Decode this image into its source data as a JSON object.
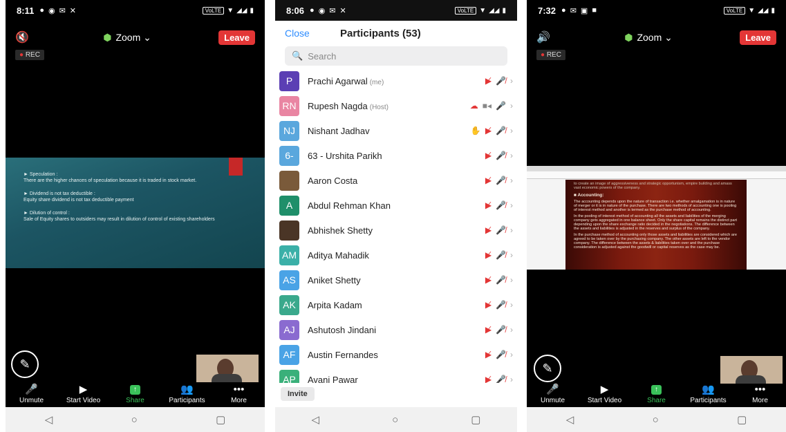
{
  "left": {
    "time": "8:11",
    "network_badge": "VoLTE",
    "meeting_name": "Zoom",
    "leave_label": "Leave",
    "rec_label": "REC",
    "slide": {
      "b1_head": "Speculation :",
      "b1_text": "There are the higher chances of speculation because it is traded in stock market.",
      "b2_head": "Dividend is not tax deductible :",
      "b2_text": "Equity share dividend is not tax deductible payment",
      "b3_head": "Dilution of control :",
      "b3_text": "Sale of Equity shares to outsiders may result in dilution of control of existing shareholders"
    },
    "toolbar": [
      "Unmute",
      "Start Video",
      "Share",
      "Participants",
      "More"
    ]
  },
  "middle": {
    "time": "8:06",
    "network_badge": "VoLTE",
    "close_label": "Close",
    "title": "Participants (53)",
    "search_placeholder": "Search",
    "participants": [
      {
        "initials": "P",
        "name": "Prachi Agarwal",
        "tag": "(me)",
        "color": "#5b3fb4"
      },
      {
        "initials": "RN",
        "name": "Rupesh Nagda",
        "tag": "(Host)",
        "color": "#e985a2"
      },
      {
        "initials": "NJ",
        "name": "Nishant Jadhav",
        "tag": "",
        "color": "#5aa7dd"
      },
      {
        "initials": "6-",
        "name": "63 - Urshita Parikh",
        "tag": "",
        "color": "#5aa7dd"
      },
      {
        "initials": "",
        "name": "Aaron Costa",
        "tag": "",
        "color": "#7a5a3a"
      },
      {
        "initials": "A",
        "name": "Abdul Rehman Khan",
        "tag": "",
        "color": "#1f8f6a"
      },
      {
        "initials": "",
        "name": "Abhishek Shetty",
        "tag": "",
        "color": "#4a3526"
      },
      {
        "initials": "AM",
        "name": "Aditya Mahadik",
        "tag": "",
        "color": "#3bb0a8"
      },
      {
        "initials": "AS",
        "name": "Aniket Shetty",
        "tag": "",
        "color": "#4aa3e6"
      },
      {
        "initials": "AK",
        "name": "Arpita Kadam",
        "tag": "",
        "color": "#3aa98c"
      },
      {
        "initials": "AJ",
        "name": "Ashutosh Jindani",
        "tag": "",
        "color": "#8a6bd0"
      },
      {
        "initials": "AF",
        "name": "Austin Fernandes",
        "tag": "",
        "color": "#4aa3e6"
      },
      {
        "initials": "AP",
        "name": "Avani Pawar",
        "tag": "",
        "color": "#3ab07a"
      }
    ],
    "invite_label": "Invite"
  },
  "right": {
    "time": "7:32",
    "network_badge": "VoLTE",
    "meeting_name": "Zoom",
    "leave_label": "Leave",
    "rec_label": "REC",
    "doc_heading": "Accounting:",
    "doc_p1": "The accounting depends upon the nature of transaction i.e. whether amalgamation is in nature of merger or it is in nature of the purchase. There are two methods of accounting one is pooling of interest method and another is termed as the purchase method of accounting.",
    "doc_p2": "In the pooling of interest method of accounting all the assets and liabilities of the merging company gets aggregated in one balance sheet. Only the share capital remains the distinct part depending upon the share exchange ratio decided in the negotiations. The difference between the assets and liabilities is adjusted in the reserves and surplus of the company.",
    "doc_p3": "In the purchase method of accounting only those assets and liabilities are considered which are agreed to be taken over by the purchasing company. The other assets are left to the vendor company. The difference between the assets & liabilities taken over and the purchase consideration is adjusted against the goodwill or capital reserves as the case may be.",
    "doc_top": "to create an image of aggressiveness and strategic opportunism, empire building and amass vast economic powers of the company.",
    "toolbar": [
      "Unmute",
      "Start Video",
      "Share",
      "Participants",
      "More"
    ]
  }
}
